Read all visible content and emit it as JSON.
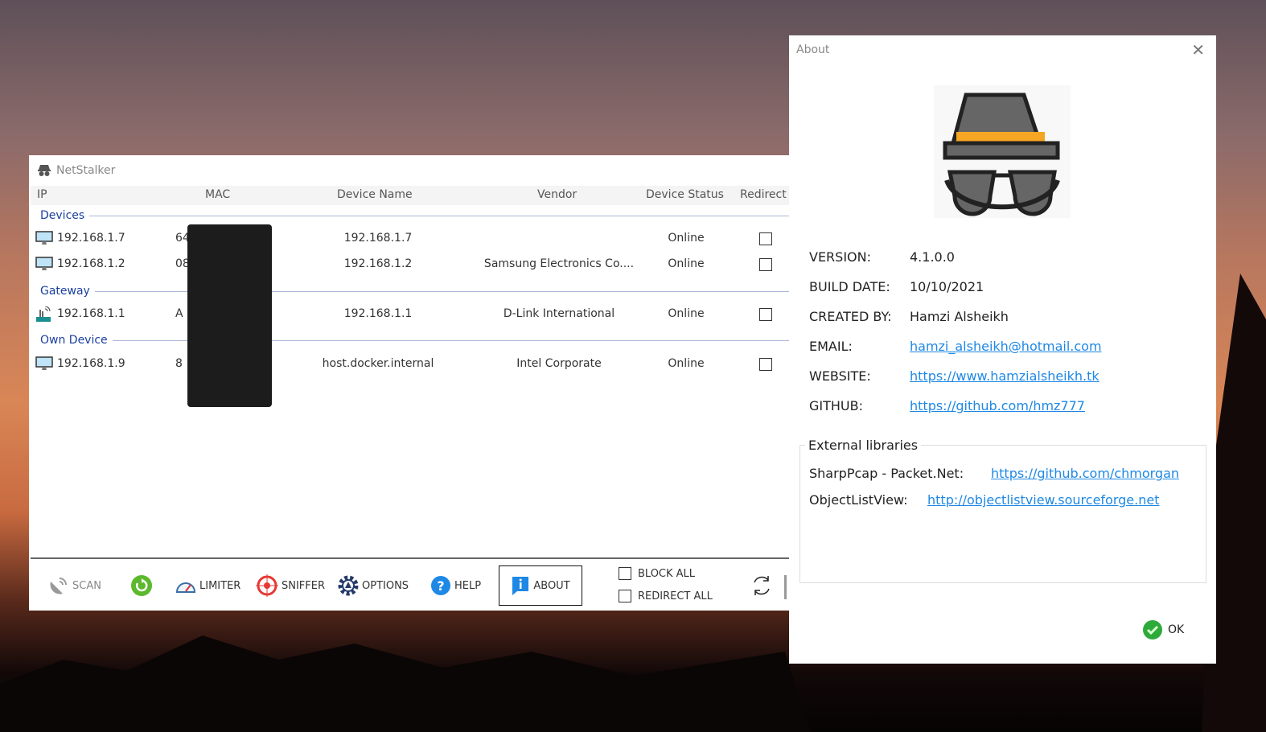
{
  "main": {
    "title": "NetStalker",
    "columns": [
      "IP",
      "MAC",
      "Device Name",
      "Vendor",
      "Device Status",
      "Redirect"
    ],
    "groups": [
      "Devices",
      "Gateway",
      "Own Device"
    ],
    "rows": [
      {
        "ip": "192.168.1.7",
        "mac": "64",
        "name": "192.168.1.7",
        "vendor": "",
        "status": "Online",
        "icon": "monitor-icon",
        "redirect": false
      },
      {
        "ip": "192.168.1.2",
        "mac": "08",
        "name": "192.168.1.2",
        "vendor": "Samsung Electronics Co....",
        "status": "Online",
        "icon": "monitor-icon",
        "redirect": false
      },
      {
        "ip": "192.168.1.1",
        "mac": "A",
        "name": "192.168.1.1",
        "vendor": "D-Link International",
        "status": "Online",
        "icon": "router-icon",
        "redirect": false
      },
      {
        "ip": "192.168.1.9",
        "mac": "8",
        "name": "host.docker.internal",
        "vendor": "Intel Corporate",
        "status": "Online",
        "icon": "monitor-icon",
        "redirect": false
      }
    ],
    "toolbar": {
      "scan": "SCAN",
      "limiter": "LIMITER",
      "sniffer": "SNIFFER",
      "options": "OPTIONS",
      "help": "HELP",
      "about": "ABOUT",
      "block_all": "BLOCK ALL",
      "redirect_all": "REDIRECT ALL"
    }
  },
  "about": {
    "title": "About",
    "info": [
      {
        "k": "VERSION:",
        "v": "4.1.0.0"
      },
      {
        "k": "BUILD DATE:",
        "v": "10/10/2021"
      },
      {
        "k": "CREATED BY:",
        "v": "Hamzi Alsheikh"
      }
    ],
    "links": [
      {
        "k": "EMAIL:",
        "v": "hamzi_alsheikh@hotmail.com"
      },
      {
        "k": "WEBSITE:",
        "v": "https://www.hamzialsheikh.tk"
      },
      {
        "k": "GITHUB:",
        "v": "https://github.com/hmz777"
      }
    ],
    "libraries_title": "External libraries",
    "libraries": [
      {
        "k": "SharpPcap - Packet.Net:",
        "v": "https://github.com/chmorgan"
      },
      {
        "k": "ObjectListView:",
        "v": "http://objectlistview.sourceforge.net"
      }
    ],
    "ok": "OK"
  },
  "colors": {
    "link": "#1e88e5",
    "group": "#1a3fa0",
    "ok": "#2eaa3a"
  }
}
